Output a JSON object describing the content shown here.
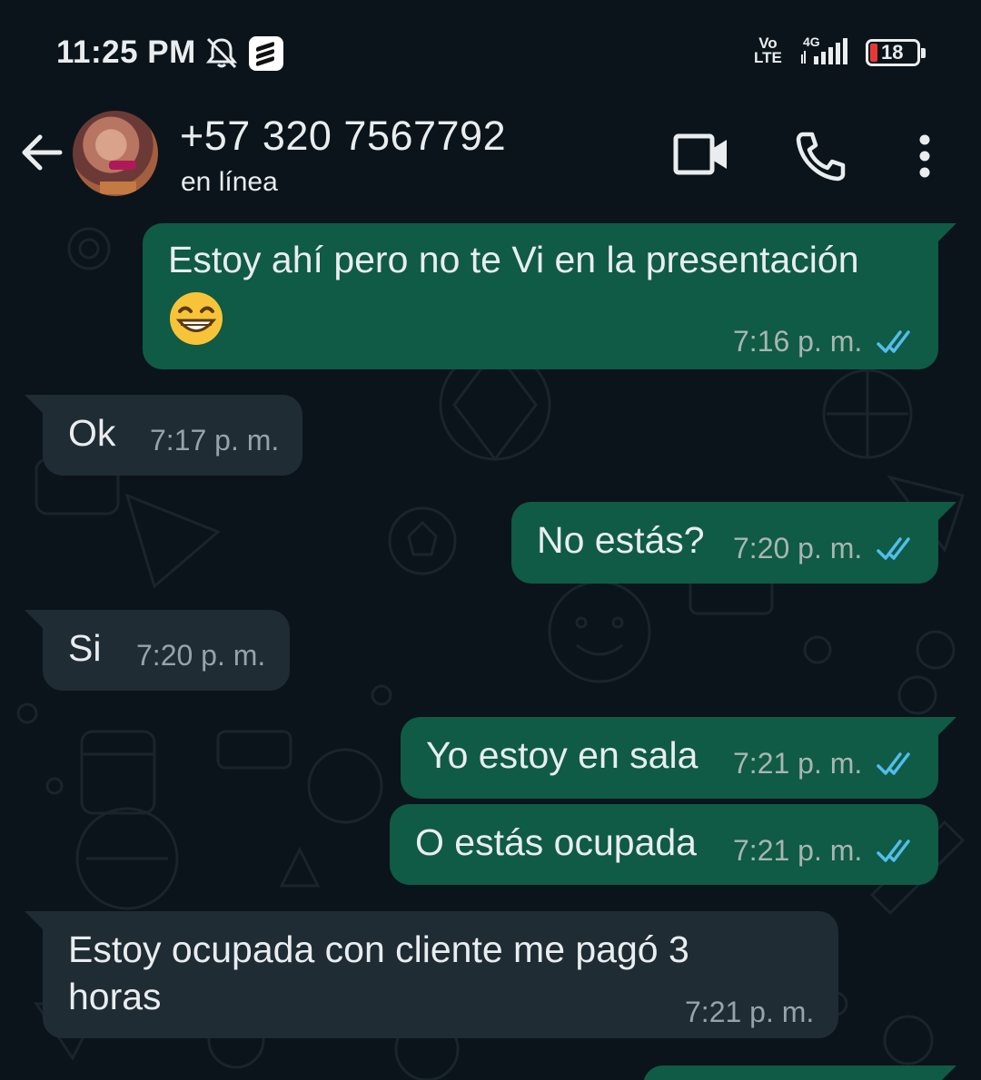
{
  "status_bar": {
    "time": "11:25 PM",
    "network_top": "Vo",
    "network_bottom": "LTE",
    "network_type": "4G",
    "battery": "18",
    "icons": [
      "mute-bell-icon",
      "app-notification-icon",
      "signal-icon",
      "battery-icon"
    ],
    "battery_color": "#e53935"
  },
  "header": {
    "contact_name": "+57 320 7567792",
    "contact_status": "en línea",
    "icons": [
      "back-arrow-icon",
      "avatar",
      "video-call-icon",
      "phone-icon",
      "more-vert-icon"
    ]
  },
  "colors": {
    "background": "#0b141a",
    "outgoing_bubble": "#0f5b45",
    "incoming_bubble": "#1f2c34",
    "read_ticks": "#53bdeb"
  },
  "messages": [
    {
      "direction": "out",
      "text": "Estoy ahí pero no te Vi en la presentación",
      "emoji": "grinning-face-emoji",
      "time": "7:16 p. m.",
      "status": "read"
    },
    {
      "direction": "in",
      "text": "Ok",
      "time": "7:17 p. m."
    },
    {
      "direction": "out",
      "text": "No estás?",
      "time": "7:20 p. m.",
      "status": "read"
    },
    {
      "direction": "in",
      "text": "Si",
      "time": "7:20 p. m."
    },
    {
      "direction": "out",
      "text": "Yo estoy en sala",
      "time": "7:21 p. m.",
      "status": "read"
    },
    {
      "direction": "out",
      "text": "O estás ocupada",
      "time": "7:21 p. m.",
      "status": "read"
    },
    {
      "direction": "in",
      "text_line1": "Estoy ocupada con cliente me pagó 3",
      "text_line2": "horas",
      "time": "7:21 p. m."
    }
  ]
}
